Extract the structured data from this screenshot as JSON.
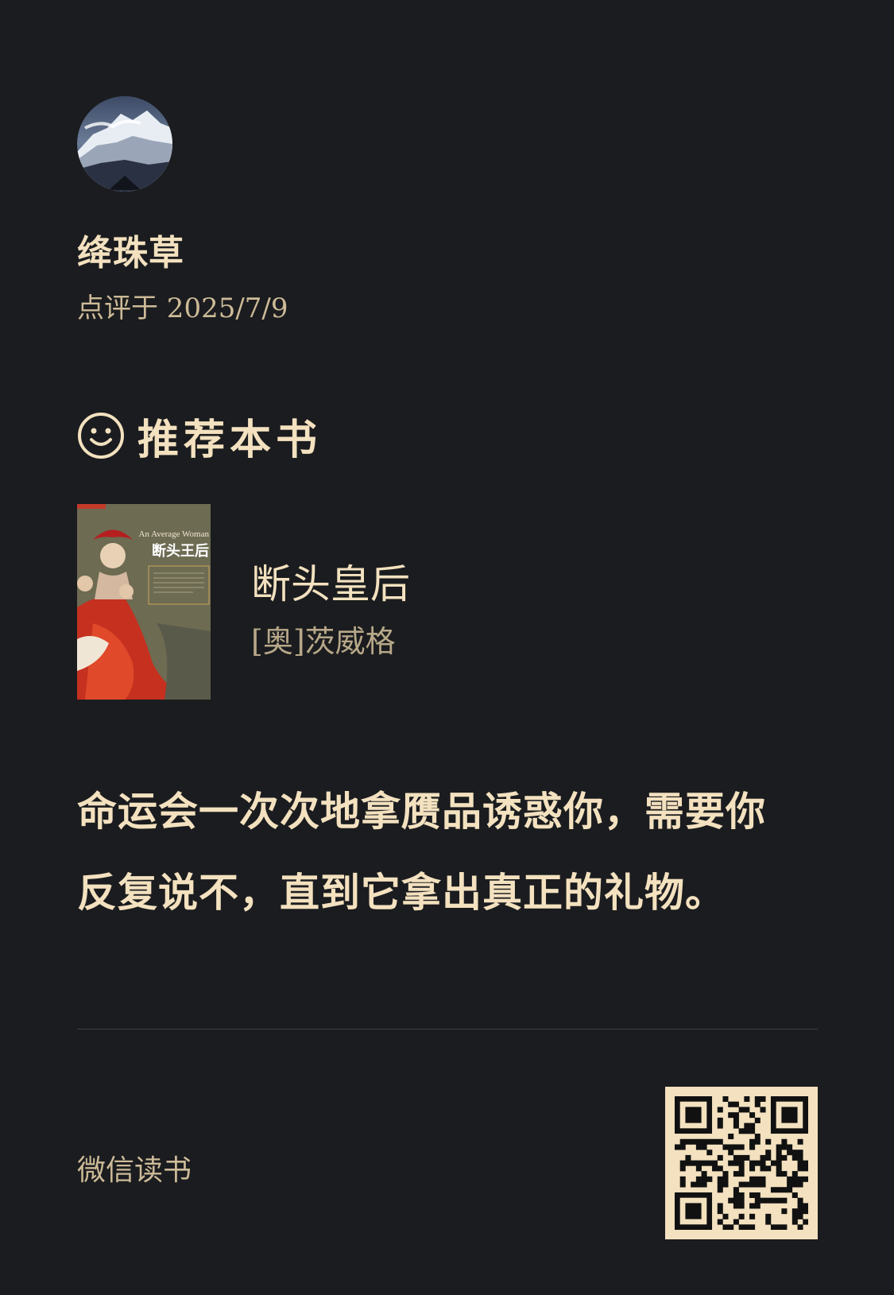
{
  "user": {
    "name": "绛珠草",
    "review_date": "点评于 2025/7/9"
  },
  "recommendation": {
    "label": "推荐本书",
    "icon": "smile-icon"
  },
  "book": {
    "title": "断头皇后",
    "author": "[奥]茨威格",
    "cover_title_en": "An Average Woman",
    "cover_title_cn": "断头王后"
  },
  "quote": {
    "line1": "命运会一次次地拿赝品诱惑你，需要你",
    "line2": "反复说不，直到它拿出真正的礼物。"
  },
  "footer": {
    "brand": "微信读书",
    "qr_icon": "qr-code-icon"
  },
  "colors": {
    "background": "#1b1c1f",
    "text": "#f3e1bf",
    "muted": "#cdbb98",
    "author": "#b7a889",
    "divider": "#3d3e42"
  }
}
